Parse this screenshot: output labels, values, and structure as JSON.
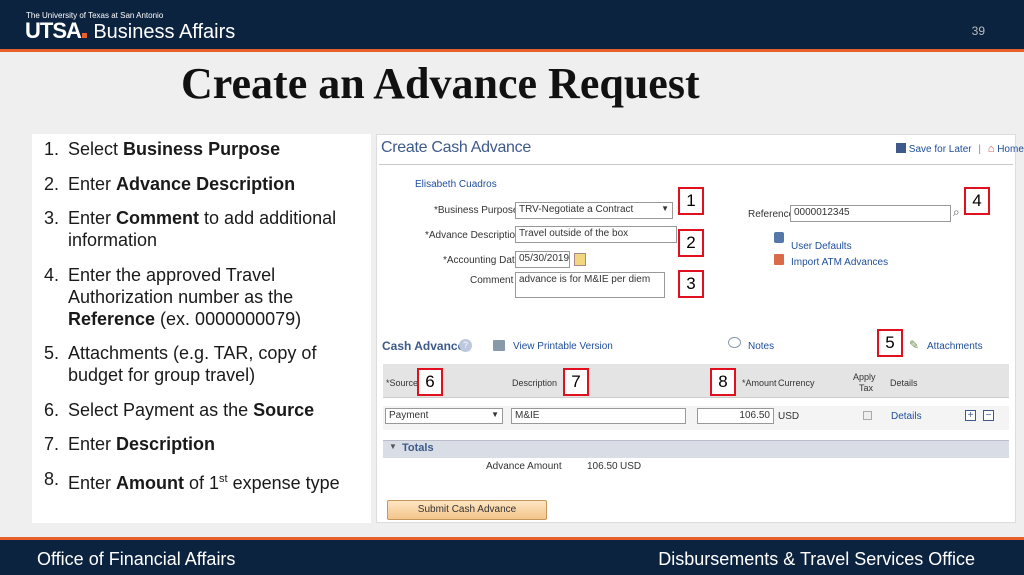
{
  "header": {
    "university": "The University of Texas at San Antonio",
    "brand_utsa": "UTSA",
    "brand_ba": "Business Affairs",
    "page_number": "39"
  },
  "title": "Create an Advance Request",
  "steps": [
    {
      "n": "1.",
      "pre": "Select ",
      "bold": "Business Purpose",
      "post": ""
    },
    {
      "n": "2.",
      "pre": "Enter ",
      "bold": "Advance Description",
      "post": ""
    },
    {
      "n": "3.",
      "pre": "Enter ",
      "bold": "Comment",
      "post": " to add additional information"
    },
    {
      "n": "4.",
      "pre": "Enter the approved Travel Authorization number as the ",
      "bold": "Reference",
      "post": " (ex. 0000000079)"
    },
    {
      "n": "5.",
      "pre": "Attachments (e.g. TAR, copy of budget for group travel)",
      "bold": "",
      "post": ""
    },
    {
      "n": "6.",
      "pre": "Select Payment as the ",
      "bold": "Source",
      "post": ""
    },
    {
      "n": "7.",
      "pre": "Enter ",
      "bold": "Description",
      "post": ""
    },
    {
      "n": "8.",
      "pre": "Enter ",
      "bold": "Amount",
      "post": " of 1",
      "sup": "st",
      "post2": " expense type"
    }
  ],
  "screen": {
    "title": "Create Cash Advance",
    "save_for_later": "Save for Later",
    "home": "Home",
    "separator": "|",
    "employee_name": "Elisabeth Cuadros",
    "business_purpose_label": "*Business Purpose",
    "business_purpose_value": "TRV-Negotiate a Contract",
    "advance_description_label": "*Advance Description",
    "advance_description_value": "Travel outside of the box",
    "accounting_date_label": "*Accounting Date",
    "accounting_date_value": "05/30/2019",
    "comment_label": "Comment",
    "comment_value": "advance is for M&IE per diem",
    "reference_label": "Reference",
    "reference_value": "0000012345",
    "user_defaults": "User Defaults",
    "import_atm": "Import ATM Advances",
    "cash_advance_heading": "Cash Advance",
    "view_printable": "View Printable Version",
    "notes": "Notes",
    "attachments": "Attachments",
    "col_source": "*Source",
    "col_description": "Description",
    "col_amount": "*Amount",
    "col_currency": "Currency",
    "col_apply_tax_1": "Apply",
    "col_apply_tax_2": "Tax",
    "col_details": "Details",
    "row_source": "Payment",
    "row_description": "M&IE",
    "row_amount": "106.50",
    "row_currency": "USD",
    "row_details": "Details",
    "totals_heading": "Totals",
    "advance_amount_label": "Advance Amount",
    "advance_amount_value": "106.50",
    "advance_amount_currency": "USD",
    "submit_button": "Submit Cash Advance",
    "add_row": "+",
    "remove_row": "−"
  },
  "callouts": [
    "1",
    "2",
    "3",
    "4",
    "5",
    "6",
    "7",
    "8"
  ],
  "footer": {
    "left": "Office of Financial Affairs",
    "right": "Disbursements & Travel Services Office"
  }
}
